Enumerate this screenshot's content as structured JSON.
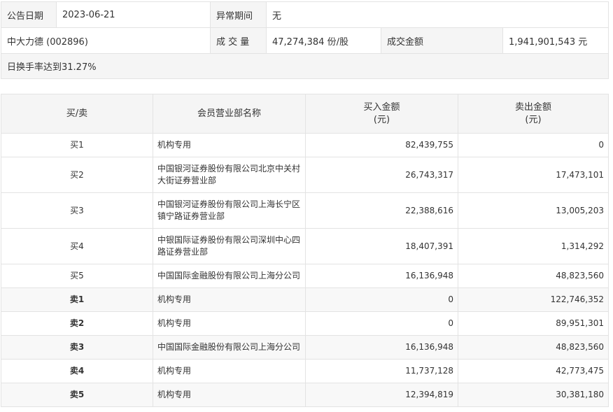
{
  "info": {
    "date_label": "公告日期",
    "date_value": "2023-06-21",
    "abnormal_label": "异常期间",
    "abnormal_value": "无",
    "stock": "中大力德 (002896)",
    "volume_label": "成 交 量",
    "volume_value": "47,274,384 份/股",
    "amount_label": "成交金额",
    "amount_value": "1,941,901,543 元",
    "note": "日换手率达到31.27%"
  },
  "table": {
    "headers": {
      "side": "买/卖",
      "dept": "会员营业部名称",
      "buy_line1": "买入金额",
      "buy_line2": "(元)",
      "sell_line1": "卖出金额",
      "sell_line2": "(元)"
    },
    "rows": [
      {
        "side": "买1",
        "dept": "机构专用",
        "buy": "82,439,755",
        "sell": "0"
      },
      {
        "side": "买2",
        "dept": "中国银河证券股份有限公司北京中关村大街证券营业部",
        "buy": "26,743,317",
        "sell": "17,473,101"
      },
      {
        "side": "买3",
        "dept": "中国银河证券股份有限公司上海长宁区镇宁路证券营业部",
        "buy": "22,388,616",
        "sell": "13,005,203"
      },
      {
        "side": "买4",
        "dept": "中银国际证券股份有限公司深圳中心四路证券营业部",
        "buy": "18,407,391",
        "sell": "1,314,292"
      },
      {
        "side": "买5",
        "dept": "中国国际金融股份有限公司上海分公司",
        "buy": "16,136,948",
        "sell": "48,823,560"
      },
      {
        "side": "卖1",
        "dept": "机构专用",
        "buy": "0",
        "sell": "122,746,352"
      },
      {
        "side": "卖2",
        "dept": "机构专用",
        "buy": "0",
        "sell": "89,951,301"
      },
      {
        "side": "卖3",
        "dept": "中国国际金融股份有限公司上海分公司",
        "buy": "16,136,948",
        "sell": "48,823,560"
      },
      {
        "side": "卖4",
        "dept": "机构专用",
        "buy": "11,737,128",
        "sell": "42,773,475"
      },
      {
        "side": "卖5",
        "dept": "机构专用",
        "buy": "12,394,819",
        "sell": "30,381,180"
      }
    ]
  }
}
